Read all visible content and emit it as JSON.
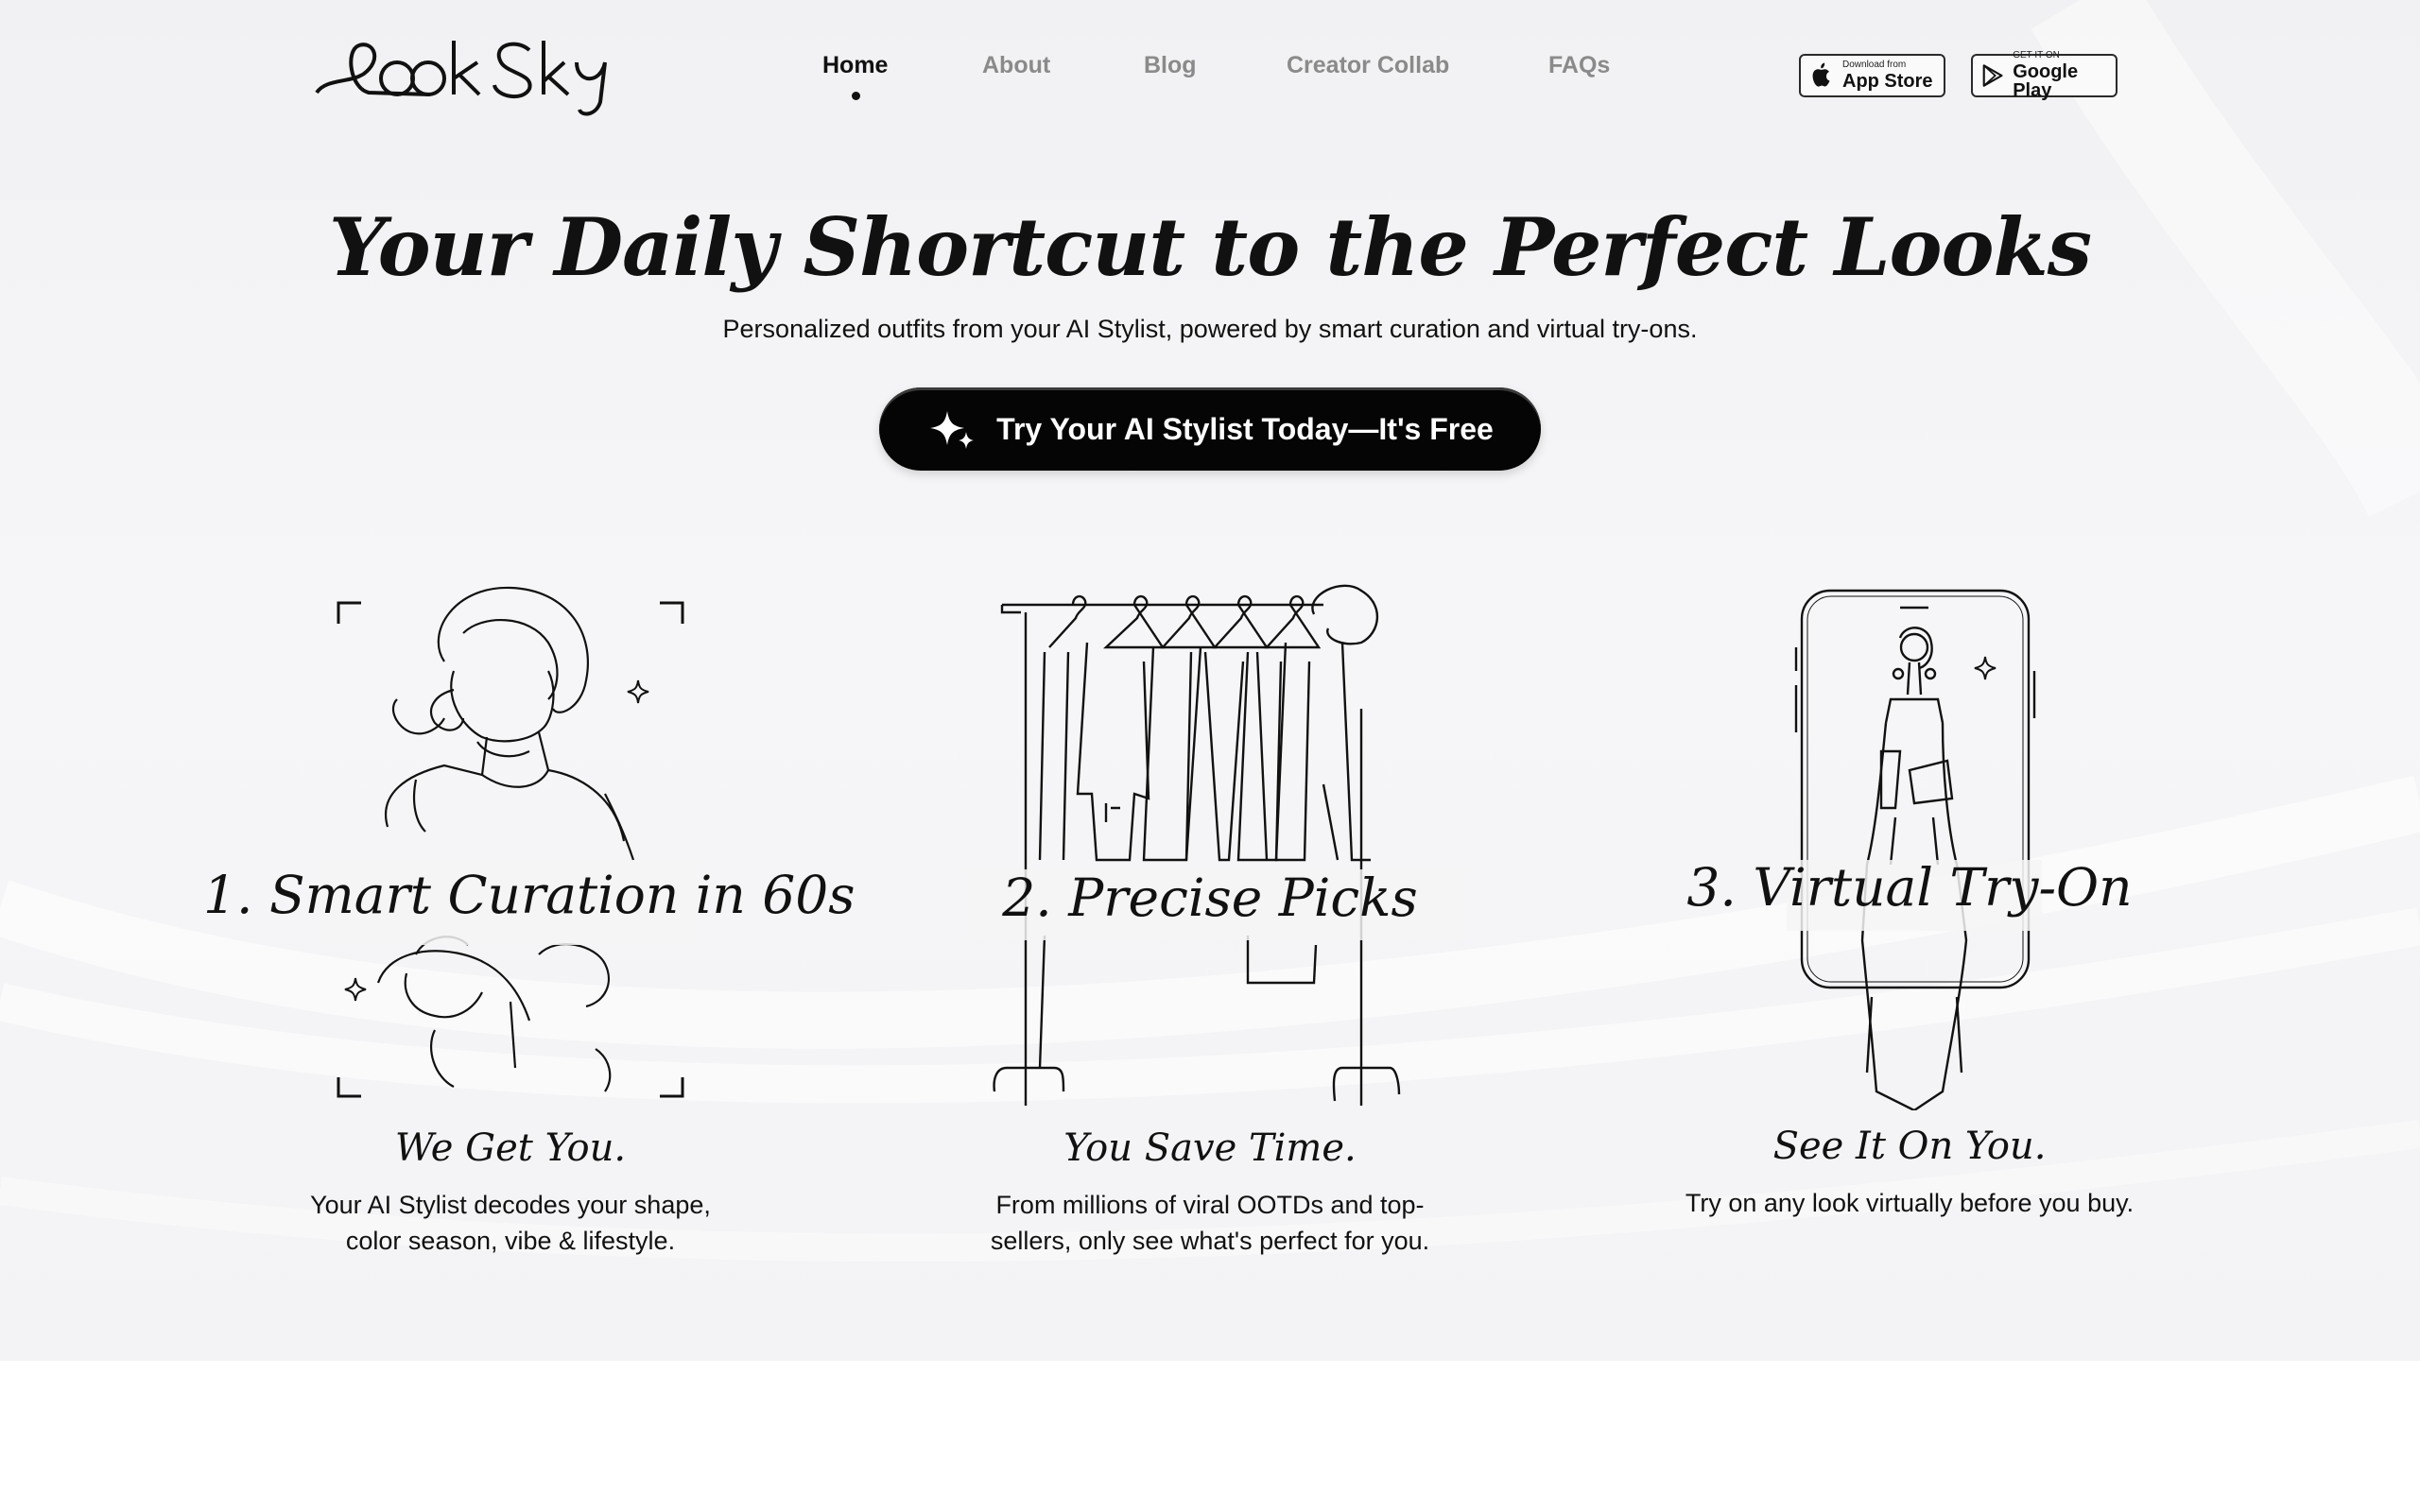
{
  "brand": {
    "name": "LookSky"
  },
  "nav": {
    "items": [
      {
        "label": "Home",
        "active": true
      },
      {
        "label": "About",
        "active": false
      },
      {
        "label": "Blog",
        "active": false
      },
      {
        "label": "Creator Collab",
        "active": false
      },
      {
        "label": "FAQs",
        "active": false
      }
    ]
  },
  "stores": {
    "app_store": {
      "small": "Download from",
      "big": "App Store",
      "icon": "apple-icon"
    },
    "google_play": {
      "small": "GET IT ON",
      "big": "Google Play",
      "icon": "google-play-icon"
    }
  },
  "hero": {
    "title": "Your Daily Shortcut to the Perfect Looks",
    "subtitle": "Personalized outfits from your AI Stylist, powered by smart curation and virtual try-ons.",
    "cta": {
      "label": "Try Your AI Stylist Today—It's Free",
      "icon": "sparkles-icon"
    }
  },
  "steps": [
    {
      "title": "1. Smart Curation in 60s",
      "subtitle": "We Get You.",
      "desc_line1": "Your AI Stylist decodes your shape,",
      "desc_line2": "color season, vibe & lifestyle."
    },
    {
      "title": "2. Precise Picks",
      "subtitle": "You Save Time.",
      "desc_line1": "From millions of viral OOTDs and top-",
      "desc_line2": "sellers, only see what's perfect for you."
    },
    {
      "title": "3. Virtual Try-On",
      "subtitle": "See It On You.",
      "desc_line1": "Try on any look virtually before you buy.",
      "desc_line2": ""
    }
  ],
  "colors": {
    "background": "#f3f3f5",
    "text": "#111111",
    "muted": "#8a8a8a",
    "cta_bg": "#050505",
    "cta_text": "#ffffff"
  }
}
